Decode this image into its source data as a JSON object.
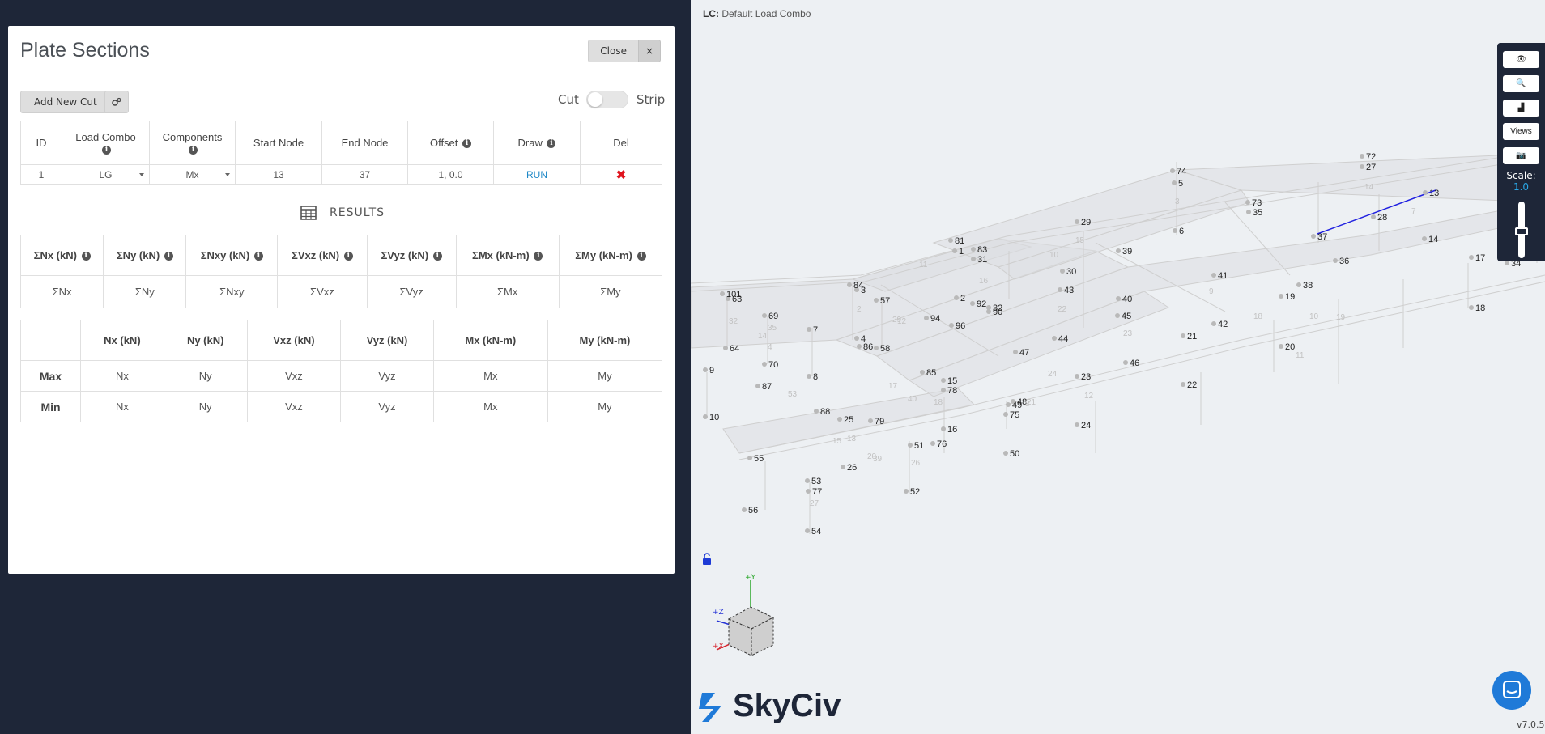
{
  "modal": {
    "title": "Plate Sections",
    "close_label": "Close",
    "close_x": "×",
    "add_cut_label": "Add New Cut",
    "cut_label": "Cut",
    "strip_label": "Strip"
  },
  "cuts_table": {
    "headers": [
      "ID",
      "Load Combo",
      "Components",
      "Start Node",
      "End Node",
      "Offset",
      "Draw",
      "Del"
    ],
    "row": {
      "id": "1",
      "load_combo": "LG",
      "component": "Mx",
      "start_node": "13",
      "end_node": "37",
      "offset": "1, 0.0",
      "draw": "RUN",
      "del": "✖"
    }
  },
  "results": {
    "label": "RESULTS",
    "sum_headers": [
      "ΣNx (kN)",
      "ΣNy (kN)",
      "ΣNxy (kN)",
      "ΣVxz (kN)",
      "ΣVyz (kN)",
      "ΣMx (kN-m)",
      "ΣMy (kN-m)"
    ],
    "sum_values": [
      "ΣNx",
      "ΣNy",
      "ΣNxy",
      "ΣVxz",
      "ΣVyz",
      "ΣMx",
      "ΣMy"
    ],
    "mm_headers": [
      "Nx (kN)",
      "Ny (kN)",
      "Vxz (kN)",
      "Vyz (kN)",
      "Mx (kN-m)",
      "My (kN-m)"
    ],
    "max_label": "Max",
    "min_label": "Min",
    "max_values": [
      "Nx",
      "Ny",
      "Vxz",
      "Vyz",
      "Mx",
      "My"
    ],
    "min_values": [
      "Nx",
      "Ny",
      "Vxz",
      "Vyz",
      "Mx",
      "My"
    ]
  },
  "viewport": {
    "lc_prefix": "LC:",
    "lc_value": "Default Load Combo",
    "toolbar": {
      "views_label": "Views",
      "scale_title": "Scale:",
      "scale_value": "1.0"
    },
    "axes": {
      "y": "+Y",
      "z": "+Z",
      "x": "+X"
    },
    "brand": "SkyCiv",
    "version": "v7.0.5",
    "node_labels": [
      "101",
      "63",
      "64",
      "9",
      "10",
      "69",
      "70",
      "7",
      "8",
      "84",
      "3",
      "4",
      "86",
      "87",
      "88",
      "55",
      "56",
      "53",
      "77",
      "54",
      "57",
      "58",
      "2",
      "94",
      "96",
      "92",
      "32",
      "90",
      "81",
      "1",
      "83",
      "31",
      "85",
      "15",
      "78",
      "16",
      "25",
      "79",
      "51",
      "76",
      "26",
      "52",
      "49",
      "48",
      "75",
      "50",
      "47",
      "44",
      "43",
      "30",
      "29",
      "39",
      "40",
      "45",
      "46",
      "23",
      "24",
      "41",
      "42",
      "21",
      "22",
      "19",
      "20",
      "38",
      "36",
      "6",
      "74",
      "5",
      "73",
      "35",
      "72",
      "27",
      "13",
      "28",
      "37",
      "14",
      "17",
      "18",
      "34"
    ],
    "plate_labels": [
      "32",
      "14",
      "35",
      "4",
      "11",
      "2",
      "29",
      "12",
      "53",
      "17",
      "40",
      "18",
      "15",
      "13",
      "20",
      "39",
      "26",
      "27",
      "16",
      "10",
      "15",
      "22",
      "24",
      "23",
      "12",
      "8",
      "21",
      "9",
      "18",
      "19",
      "10",
      "11",
      "3",
      "14",
      "7"
    ]
  }
}
